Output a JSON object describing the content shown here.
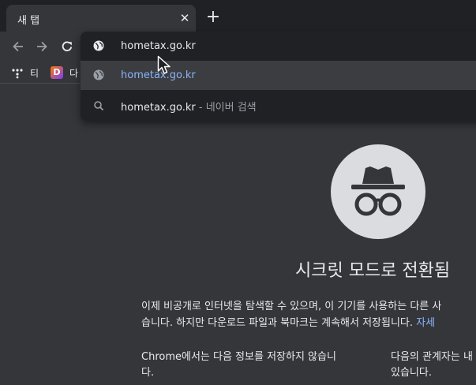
{
  "tab": {
    "title": "새 탭",
    "close": "✕"
  },
  "new_tab": "+",
  "bookmarks": [
    {
      "label": "티"
    },
    {
      "label": "다"
    }
  ],
  "omnibox": {
    "typed": "hometax.go.kr",
    "suggestions": [
      {
        "icon": "globe-icon",
        "text": "hometax.go.kr"
      },
      {
        "icon": "search-icon",
        "text": "hometax.go.kr",
        "separator": " - ",
        "engine": "네이버 검색"
      }
    ]
  },
  "incognito": {
    "title": "시크릿 모드로 전환됨",
    "para_line1": "이제 비공개로 인터넷을 탐색할 수 있으며, 이 기기를 사용하는 다른 사",
    "para_line2": "습니다. 하지만 다운로드 파일과 북마크는 계속해서 저장됩니다. ",
    "para_link": "자세",
    "left_col_line1": "Chrome에서는 다음 정보를 저장하지 않습니",
    "left_col_line2": "다.",
    "right_col_line1": "다음의 관계자는 내",
    "right_col_line2": "있습니다."
  },
  "colors": {
    "background": "#35363a",
    "tabstrip": "#202124",
    "link": "#8ab4f8"
  }
}
